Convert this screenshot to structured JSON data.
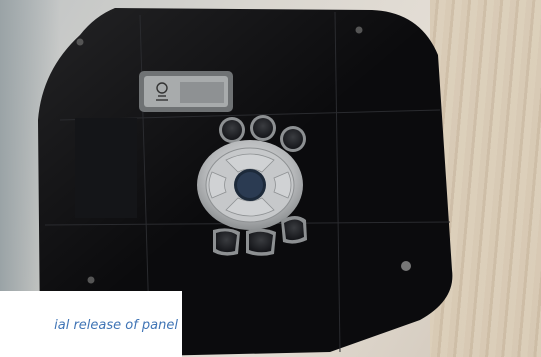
{
  "caption": {
    "text": "ial release of panel"
  },
  "panel": {
    "controls": {
      "center_label": "",
      "buttons": [
        "top-button-1",
        "top-button-2",
        "top-button-3",
        "dpad-up",
        "dpad-left",
        "dpad-right",
        "dpad-down",
        "bottom-button-1",
        "bottom-button-2",
        "bottom-button-3"
      ]
    },
    "icons": [
      "display-icon"
    ]
  },
  "colors": {
    "panel": "#0b0b0d",
    "caption_text": "#3f74b5",
    "button_silver": "#b9bbbd"
  }
}
